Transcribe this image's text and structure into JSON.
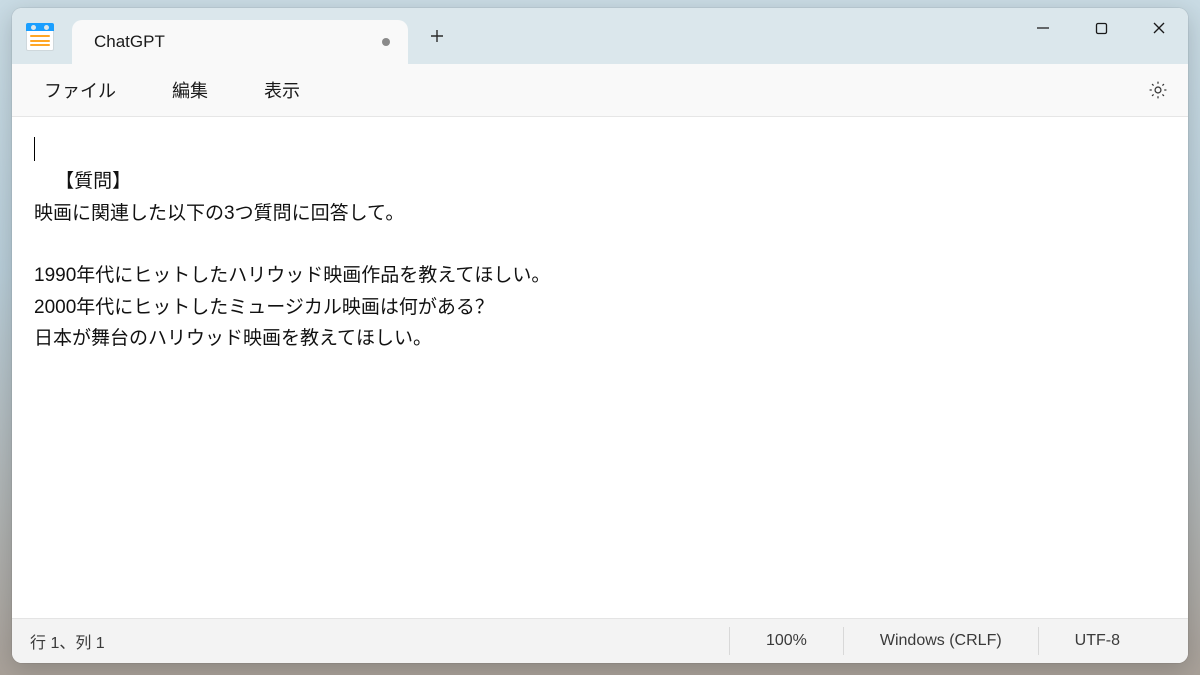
{
  "tab": {
    "title": "ChatGPT"
  },
  "menubar": {
    "file": "ファイル",
    "edit": "編集",
    "view": "表示"
  },
  "editor": {
    "content": "【質問】\n映画に関連した以下の3つ質問に回答して。\n\n1990年代にヒットしたハリウッド映画作品を教えてほしい。\n2000年代にヒットしたミュージカル映画は何がある？\n日本が舞台のハリウッド映画を教えてほしい。"
  },
  "statusbar": {
    "position": "行 1、列 1",
    "zoom": "100%",
    "line_ending": "Windows (CRLF)",
    "encoding": "UTF-8"
  }
}
